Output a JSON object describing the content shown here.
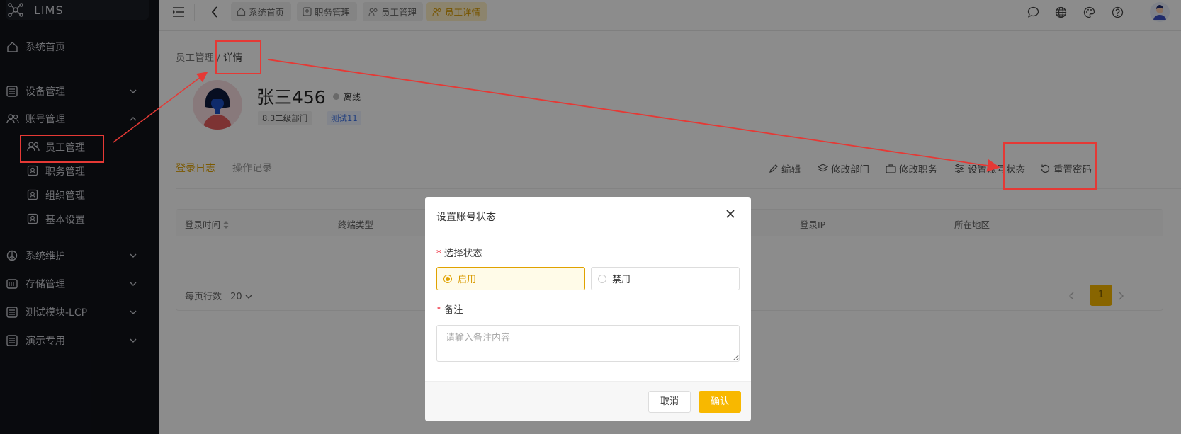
{
  "app": {
    "name": "LIMS"
  },
  "sidebar": {
    "items": [
      {
        "label": "系统首页"
      },
      {
        "label": "设备管理"
      },
      {
        "label": "账号管理"
      },
      {
        "label": "员工管理"
      },
      {
        "label": "职务管理"
      },
      {
        "label": "组织管理"
      },
      {
        "label": "基本设置"
      },
      {
        "label": "系统维护"
      },
      {
        "label": "存储管理"
      },
      {
        "label": "测试模块-LCP"
      },
      {
        "label": "演示专用"
      }
    ]
  },
  "topbar": {
    "tabs": [
      {
        "label": "系统首页"
      },
      {
        "label": "职务管理"
      },
      {
        "label": "员工管理"
      },
      {
        "label": "员工详情"
      }
    ]
  },
  "breadcrumb": {
    "parent": "员工管理",
    "sep": " / ",
    "current": "详情"
  },
  "profile": {
    "name": "张三456",
    "status": "离线",
    "department": "8.3二级部门",
    "tag": "测试11"
  },
  "tabs": {
    "login_log": "登录日志",
    "operation_log": "操作记录"
  },
  "actions": {
    "edit": "编辑",
    "change_dept": "修改部门",
    "change_post": "修改职务",
    "set_status": "设置账号状态",
    "reset_pwd": "重置密码"
  },
  "table": {
    "columns": [
      "登录时间",
      "终端类型",
      "登录IP",
      "所在地区"
    ],
    "rows_per_page_label": "每页行数",
    "rows_per_page": "20",
    "current_page": "1"
  },
  "modal": {
    "title": "设置账号状态",
    "status_label": "选择状态",
    "options": [
      "启用",
      "禁用"
    ],
    "selected": "启用",
    "remark_label": "备注",
    "remark_placeholder": "请输入备注内容",
    "cancel": "取消",
    "confirm": "确认"
  },
  "colors": {
    "accent": "#f8b800",
    "sidebar_bg": "#111319",
    "annotation": "#e53935"
  }
}
